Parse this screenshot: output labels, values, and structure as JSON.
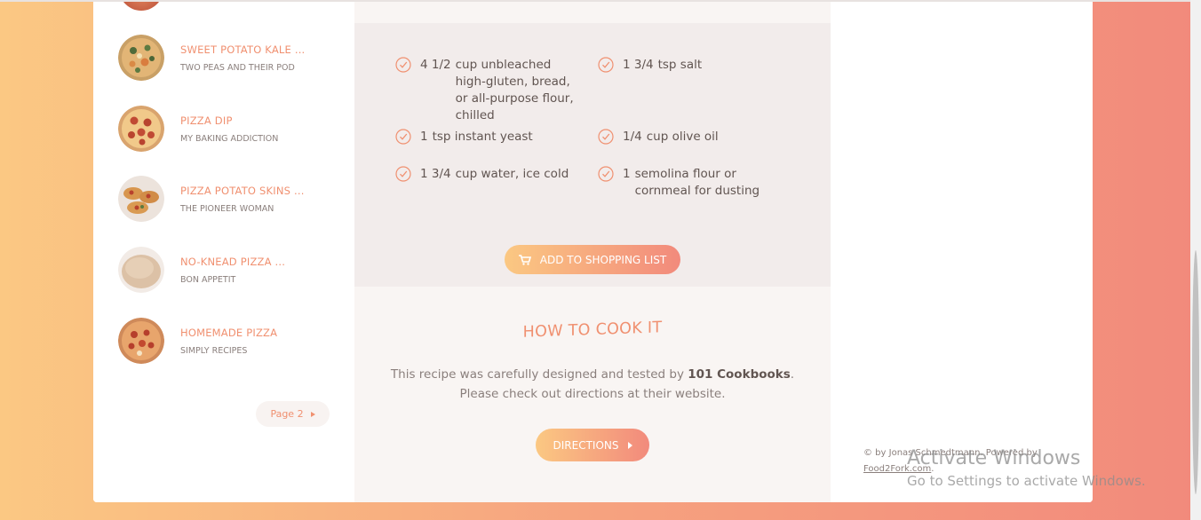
{
  "results": {
    "items": [
      {
        "title": "Sweet Potato Kale ...",
        "source": "Two Peas and Their Pod"
      },
      {
        "title": "Pizza Dip",
        "source": "My Baking Addiction"
      },
      {
        "title": "Pizza Potato Skins ...",
        "source": "The Pioneer Woman"
      },
      {
        "title": "No-Knead Pizza ...",
        "source": "Bon Appetit"
      },
      {
        "title": "Homemade Pizza",
        "source": "Simply Recipes"
      }
    ],
    "pager_label": "Page 2"
  },
  "recipe": {
    "ingredients": [
      {
        "qty": "4 1/2",
        "text": "cup unbleached high-gluten, bread, or all-purpose flour, chilled"
      },
      {
        "qty": "1 3/4",
        "text": "tsp salt"
      },
      {
        "qty": "1",
        "text": "tsp instant yeast"
      },
      {
        "qty": "1/4",
        "text": "cup olive oil"
      },
      {
        "qty": "1 3/4",
        "text": "cup water, ice cold"
      },
      {
        "qty": "1",
        "text": "semolina flour or cornmeal for dusting"
      }
    ],
    "add_to_list_label": "Add to shopping list",
    "how_title": "How to cook it",
    "how_text_1": "This recipe was carefully designed and tested by ",
    "publisher": "101 Cookbooks",
    "how_text_2": ". Please check out directions at their website.",
    "directions_label": "Directions"
  },
  "footer": {
    "copyright": "© by Jonas Schmedtmann. Powered by",
    "link": "Food2Fork.com",
    "link_suffix": "."
  },
  "watermark": {
    "line1": "Activate Windows",
    "line2": "Go to Settings to activate Windows."
  },
  "colors": {
    "accent": "#f09070",
    "gradient_start": "#fbc882",
    "gradient_end": "#f28a7c"
  }
}
